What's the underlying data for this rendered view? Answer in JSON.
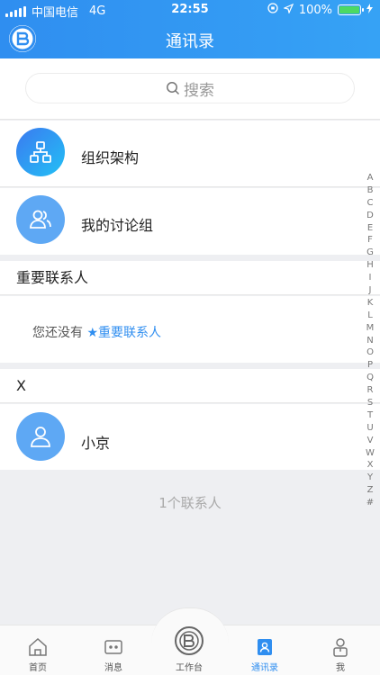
{
  "status": {
    "carrier": "中国电信",
    "network": "4G",
    "time": "22:55",
    "battery": "100%"
  },
  "nav": {
    "title": "通讯录"
  },
  "search": {
    "placeholder": "搜索"
  },
  "menu": [
    {
      "label": "组织架构",
      "icon": "org-chart-icon"
    },
    {
      "label": "我的讨论组",
      "icon": "group-icon"
    }
  ],
  "important": {
    "title": "重要联系人",
    "empty_prefix": "您还没有 ",
    "empty_link": "★重要联系人"
  },
  "section_x": {
    "title": "X"
  },
  "contacts": [
    {
      "name": "小京",
      "icon": "user-avatar-icon"
    }
  ],
  "footer": {
    "count": "1个联系人"
  },
  "index": [
    "A",
    "B",
    "C",
    "D",
    "E",
    "F",
    "G",
    "H",
    "I",
    "J",
    "K",
    "L",
    "M",
    "N",
    "O",
    "P",
    "Q",
    "R",
    "S",
    "T",
    "U",
    "V",
    "W",
    "X",
    "Y",
    "Z",
    "#"
  ],
  "tabs": [
    {
      "label": "首页",
      "icon": "home-icon"
    },
    {
      "label": "消息",
      "icon": "message-icon"
    },
    {
      "label": "工作台",
      "icon": "workbench-icon"
    },
    {
      "label": "通讯录",
      "icon": "contacts-icon",
      "active": true
    },
    {
      "label": "我",
      "icon": "profile-icon"
    }
  ],
  "colors": {
    "accent": "#2f8ef0",
    "org_gradient_start": "#3b7af0",
    "org_gradient_end": "#22c0f5",
    "avatar_blue": "#5ea8f4"
  }
}
